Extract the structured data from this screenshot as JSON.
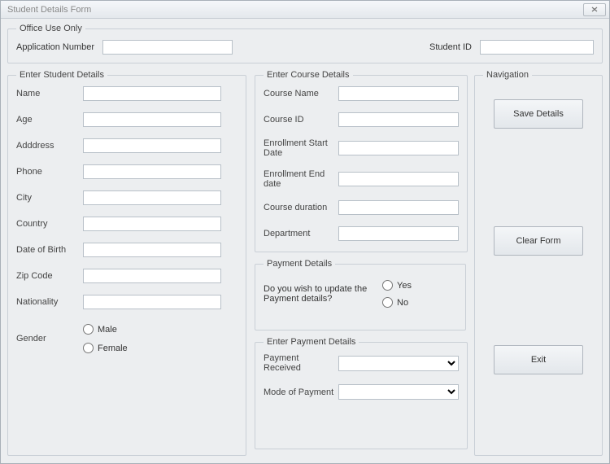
{
  "window": {
    "title": "Student Details Form"
  },
  "office": {
    "legend": "Office Use Only",
    "appnum_label": "Application Number",
    "appnum_value": "",
    "studentid_label": "Student ID",
    "studentid_value": ""
  },
  "student": {
    "legend": "Enter Student Details",
    "name_label": "Name",
    "name_value": "",
    "age_label": "Age",
    "age_value": "",
    "address_label": "Adddress",
    "address_value": "",
    "phone_label": "Phone",
    "phone_value": "",
    "city_label": "City",
    "city_value": "",
    "country_label": "Country",
    "country_value": "",
    "dob_label": "Date of Birth",
    "dob_value": "",
    "zip_label": "Zip Code",
    "zip_value": "",
    "nat_label": "Nationality",
    "nat_value": "",
    "gender_label": "Gender",
    "gender_male": "Male",
    "gender_female": "Female"
  },
  "course": {
    "legend": "Enter Course Details",
    "name_label": "Course Name",
    "name_value": "",
    "id_label": "Course ID",
    "id_value": "",
    "start_label": "Enrollment Start Date",
    "start_value": "",
    "end_label": "Enrollment End date",
    "end_value": "",
    "dur_label": "Course duration",
    "dur_value": "",
    "dept_label": "Department",
    "dept_value": ""
  },
  "payq": {
    "legend": "Payment Details",
    "question": "Do you wish to update the Payment details?",
    "yes": "Yes",
    "no": "No"
  },
  "paydetails": {
    "legend": "Enter Payment Details",
    "received_label": "Payment Received",
    "mode_label": "Mode of Payment"
  },
  "nav": {
    "legend": "Navigation",
    "save": "Save Details",
    "clear": "Clear Form",
    "exit": "Exit"
  }
}
